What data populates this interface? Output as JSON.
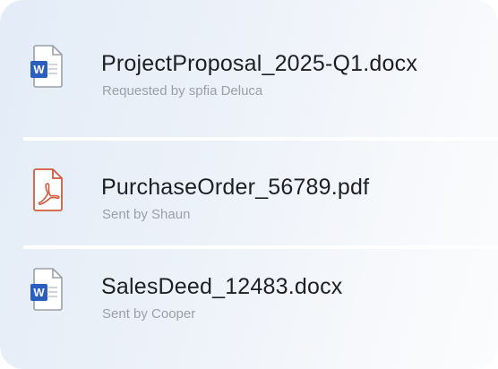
{
  "files": [
    {
      "name": "ProjectProposal_2025-Q1.docx",
      "meta": "Requested by spfia Deluca",
      "icon": "word-document-icon",
      "badge_letter": "W",
      "badge_color": "#2b5fbf"
    },
    {
      "name": "PurchaseOrder_56789.pdf",
      "meta": "Sent by Shaun",
      "icon": "pdf-document-icon",
      "accent_color": "#d45a3f"
    },
    {
      "name": "SalesDeed_12483.docx",
      "meta": "Sent by Cooper",
      "icon": "word-document-icon",
      "badge_letter": "W",
      "badge_color": "#2b5fbf"
    }
  ]
}
